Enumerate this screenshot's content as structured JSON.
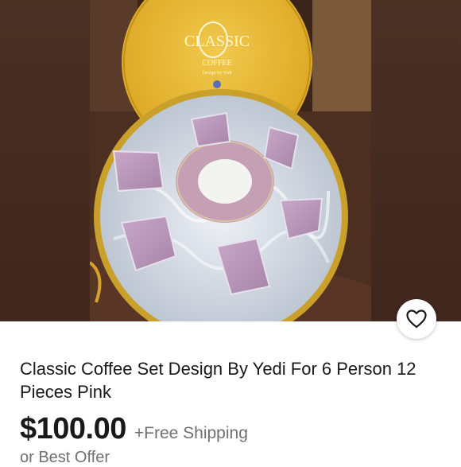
{
  "listing": {
    "image_alt": "Classic Coffee Set in round gold box",
    "box_lid_brand": "CLASSIC",
    "box_lid_sub": "COFFEE",
    "box_lid_sub2": "Design by Yedi",
    "title": "Classic Coffee Set Design By Yedi For 6 Person 12 Pieces Pink",
    "price": "$100.00",
    "shipping": "+Free Shipping",
    "best_offer": "or Best Offer"
  },
  "icons": {
    "favorite": "heart-outline-icon"
  },
  "colors": {
    "text_primary": "#191919",
    "text_secondary": "#707070",
    "photo_background": "#4a2f22"
  }
}
